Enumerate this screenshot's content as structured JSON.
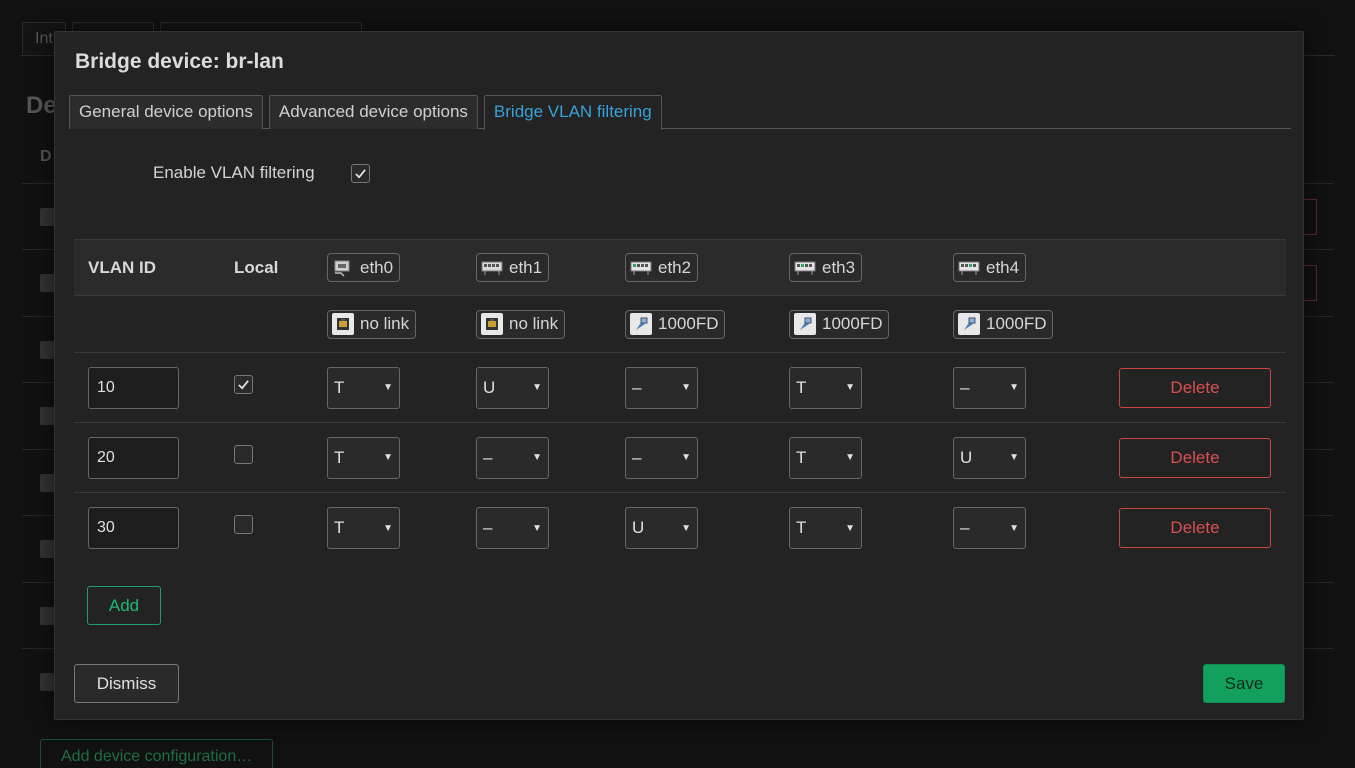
{
  "background": {
    "tabs": [
      "Int",
      "",
      ""
    ],
    "heading": "De",
    "col_header": "D",
    "add_config_label": "Add device configuration…"
  },
  "modal": {
    "title": "Bridge device: br-lan",
    "tabs": [
      {
        "label": "General device options",
        "active": false
      },
      {
        "label": "Advanced device options",
        "active": false
      },
      {
        "label": "Bridge VLAN filtering",
        "active": true
      }
    ],
    "enable_vlan_filtering": {
      "label": "Enable VLAN filtering",
      "checked": true
    },
    "table": {
      "headers": {
        "vlan_id": "VLAN ID",
        "local": "Local"
      },
      "ports": [
        {
          "name": "eth0",
          "status": "no link",
          "icon": "ethernet-port-disconnected-icon"
        },
        {
          "name": "eth1",
          "status": "no link",
          "icon": "ethernet-port-icon"
        },
        {
          "name": "eth2",
          "status": "1000FD",
          "icon": "ethernet-port-icon"
        },
        {
          "name": "eth3",
          "status": "1000FD",
          "icon": "ethernet-port-icon"
        },
        {
          "name": "eth4",
          "status": "1000FD",
          "icon": "ethernet-port-icon"
        }
      ],
      "rows": [
        {
          "vlan_id": "10",
          "local": true,
          "ports": [
            "T",
            "U",
            "–",
            "T",
            "–"
          ],
          "delete_label": "Delete"
        },
        {
          "vlan_id": "20",
          "local": false,
          "ports": [
            "T",
            "–",
            "–",
            "T",
            "U"
          ],
          "delete_label": "Delete"
        },
        {
          "vlan_id": "30",
          "local": false,
          "ports": [
            "T",
            "–",
            "U",
            "T",
            "–"
          ],
          "delete_label": "Delete"
        }
      ]
    },
    "add_label": "Add",
    "dismiss_label": "Dismiss",
    "save_label": "Save"
  },
  "colors": {
    "active_tab": "#3aa0d8",
    "delete": "#d95050",
    "add": "#1fb874",
    "save_bg": "#13a05f"
  }
}
